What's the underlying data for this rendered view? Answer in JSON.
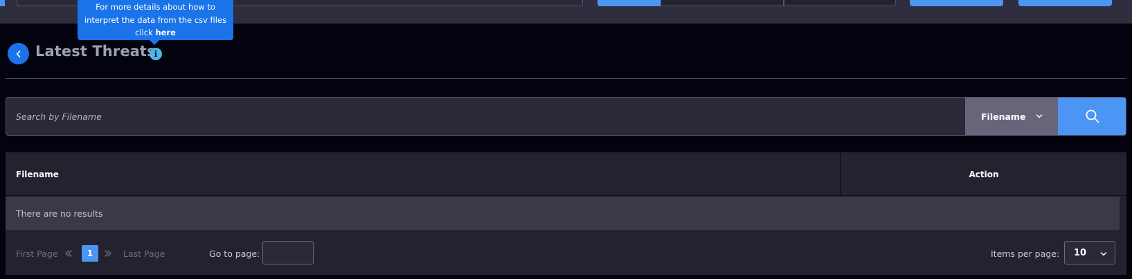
{
  "tooltip": {
    "line1": "For more details about how to",
    "line2": "interpret the data from the csv files",
    "line3_prefix": "click ",
    "line3_link": "here"
  },
  "header": {
    "title": "Latest Threats",
    "info_glyph": "i"
  },
  "search": {
    "placeholder": "Search by Filename",
    "value": "",
    "filter_selected": "Filename"
  },
  "table": {
    "columns": [
      "Filename",
      "Action"
    ],
    "empty_message": "There are no results"
  },
  "pagination": {
    "first_label": "First Page",
    "last_label": "Last Page",
    "current_page": "1",
    "goto_label": "Go to page:",
    "goto_value": "",
    "items_per_page_label": "Items per page:",
    "items_per_page_value": "10"
  },
  "colors": {
    "accent": "#4c95f5",
    "tooltip": "#1a73e8",
    "background": "#03030f",
    "panel": "#23222f"
  },
  "icons": {
    "back": "chevron-left-icon",
    "info": "info-icon",
    "search": "search-icon",
    "dropdown": "chevron-down-icon",
    "prev": "double-chevron-left-icon",
    "next": "double-chevron-right-icon"
  }
}
